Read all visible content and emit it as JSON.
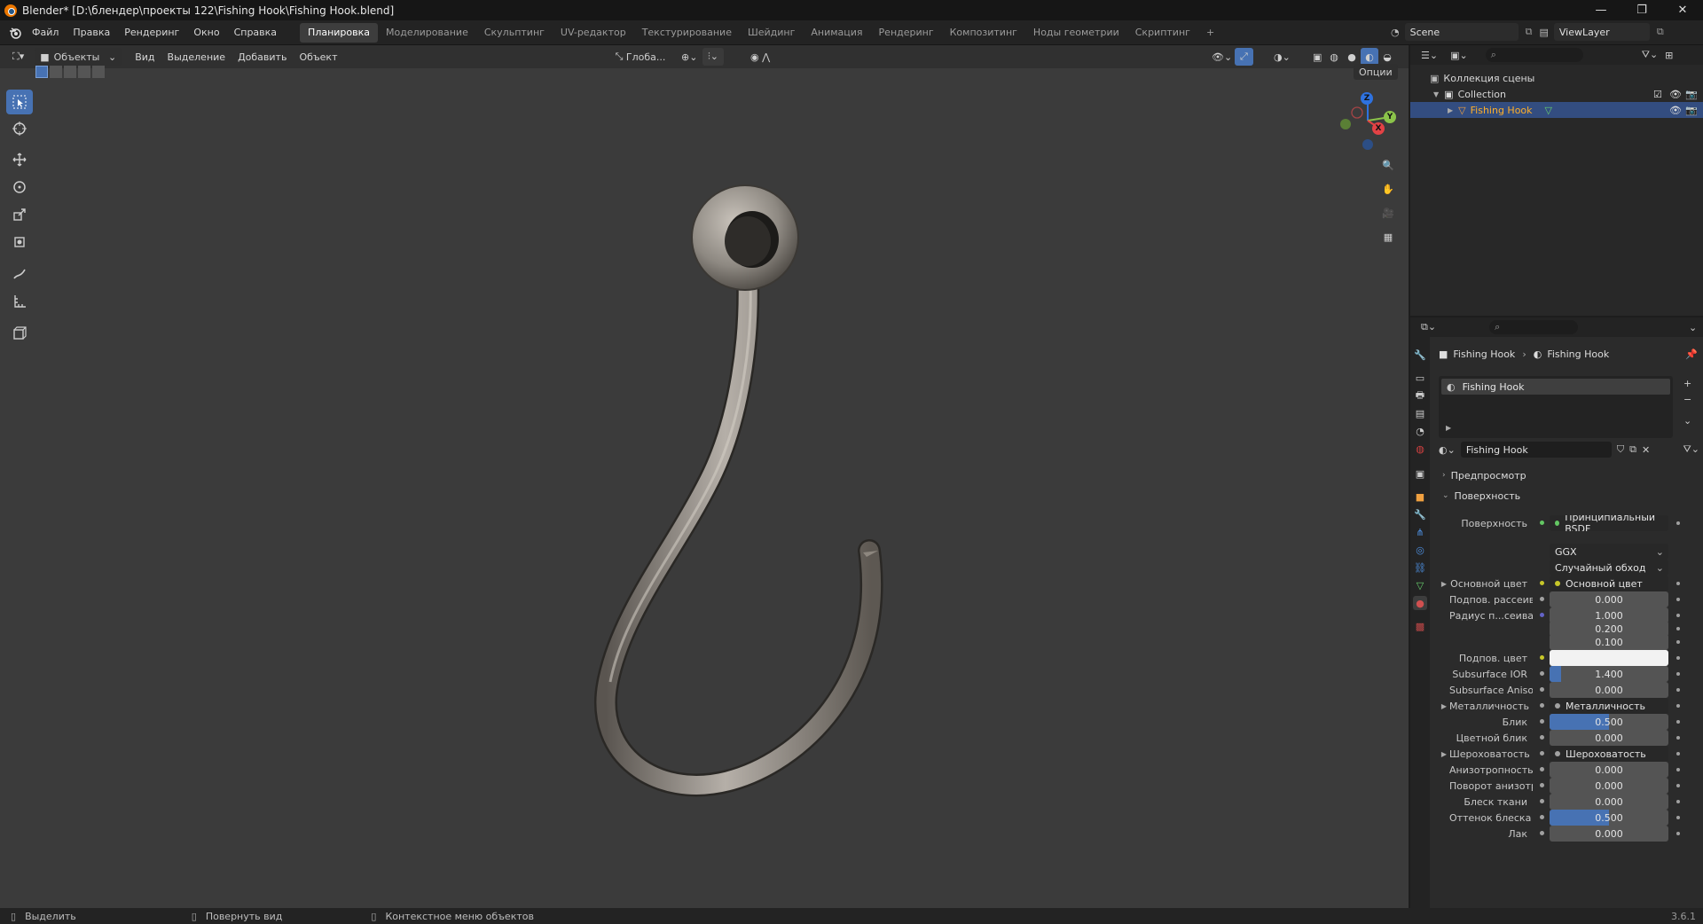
{
  "title_bar": {
    "title": "Blender* [D:\\блендер\\проекты 122\\Fishing Hook\\Fishing Hook.blend]",
    "minimize_label": "—",
    "maximize_label": "❐",
    "close_label": "✕"
  },
  "menu": [
    "Файл",
    "Правка",
    "Рендеринг",
    "Окно",
    "Справка"
  ],
  "workspaces": [
    "Планировка",
    "Моделирование",
    "Скульптинг",
    "UV-редактор",
    "Текстурирование",
    "Шейдинг",
    "Анимация",
    "Рендеринг",
    "Композитинг",
    "Ноды геометрии",
    "Скриптинг"
  ],
  "workspaces_add": "+",
  "scene": {
    "name": "Scene",
    "view_layer": "ViewLayer"
  },
  "viewport": {
    "mode": "Объекты",
    "menus": [
      "Вид",
      "Выделение",
      "Добавить",
      "Объект"
    ],
    "orientation": "Глоба...",
    "options_label": "Опции",
    "gizmo_labels": {
      "x": "X",
      "y": "Y",
      "z": "Z"
    }
  },
  "outliner": {
    "rows": [
      {
        "label": "Коллекция сцены"
      },
      {
        "label": "Collection"
      },
      {
        "label": "Fishing Hook"
      }
    ]
  },
  "properties": {
    "breadcrumb": [
      "Fishing Hook",
      "Fishing Hook"
    ],
    "material_slot": "Fishing Hook",
    "material_name": "Fishing Hook",
    "sections": {
      "preview": "Предпросмотр",
      "surface": "Поверхность"
    },
    "rows": [
      {
        "label": "Поверхность",
        "value": "Принципиальный BSDF",
        "kind": "link",
        "socket": "green"
      },
      {
        "label": "",
        "value": "GGX",
        "kind": "dropdown"
      },
      {
        "label": "",
        "value": "Случайный обход",
        "kind": "dropdown"
      },
      {
        "label": "Основной цвет",
        "value": "Основной цвет",
        "kind": "link",
        "socket": "yellow",
        "expand": true
      },
      {
        "label": "Подпов. рассеива...",
        "value": "0.000",
        "kind": "number",
        "socket": "gray",
        "fill": 0
      },
      {
        "label": "Радиус п...сеивания",
        "value": "1.000",
        "kind": "number",
        "socket": "blue",
        "fill": 0
      },
      {
        "label": "",
        "value": "0.200",
        "kind": "number",
        "fill": 0
      },
      {
        "label": "",
        "value": "0.100",
        "kind": "number",
        "fill": 0
      },
      {
        "label": "Подпов. цвет",
        "value": "",
        "kind": "color",
        "socket": "yellow",
        "color": "#f2f2f2"
      },
      {
        "label": "Subsurface IOR",
        "value": "1.400",
        "kind": "number",
        "socket": "gray",
        "fill": 0.1
      },
      {
        "label": "Subsurface Anisotr...",
        "value": "0.000",
        "kind": "number",
        "socket": "gray",
        "fill": 0
      },
      {
        "label": "Металличность",
        "value": "Металличность",
        "kind": "link",
        "socket": "gray",
        "expand": true
      },
      {
        "label": "Блик",
        "value": "0.500",
        "kind": "number",
        "socket": "gray",
        "fill": 0.5
      },
      {
        "label": "Цветной блик",
        "value": "0.000",
        "kind": "number",
        "socket": "gray",
        "fill": 0
      },
      {
        "label": "Шероховатость",
        "value": "Шероховатость",
        "kind": "link",
        "socket": "gray",
        "expand": true
      },
      {
        "label": "Анизотропность",
        "value": "0.000",
        "kind": "number",
        "socket": "gray",
        "fill": 0
      },
      {
        "label": "Поворот анизотро...",
        "value": "0.000",
        "kind": "number",
        "socket": "gray",
        "fill": 0
      },
      {
        "label": "Блеск ткани",
        "value": "0.000",
        "kind": "number",
        "socket": "gray",
        "fill": 0
      },
      {
        "label": "Оттенок блеска тк...",
        "value": "0.500",
        "kind": "number",
        "socket": "gray",
        "fill": 0.5
      },
      {
        "label": "Лак",
        "value": "0.000",
        "kind": "number",
        "socket": "gray",
        "fill": 0
      }
    ]
  },
  "status_bar": {
    "items": [
      "Выделить",
      "Повернуть вид",
      "Контекстное меню объектов"
    ],
    "version": "3.6.1"
  },
  "colors": {
    "accent": "#4772b3",
    "viewport_bg": "#3b3b3b",
    "panel_bg": "#2b2b2b"
  }
}
